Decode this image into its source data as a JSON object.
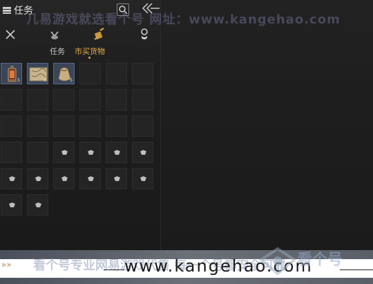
{
  "panel": {
    "title": "任务",
    "title_icon": "stack-icon",
    "search_icon": "search-icon",
    "collapse_icon": "double-chevron-left-icon"
  },
  "category_tabs": [
    {
      "icon": "crossed-swords-icon",
      "active": false
    },
    {
      "icon": "pouch-icon",
      "active": false
    },
    {
      "icon": "goods-bundle-icon",
      "active": true
    },
    {
      "icon": "coin-stack-icon",
      "active": false
    }
  ],
  "subtabs": {
    "inactive_label": "任务",
    "active_label": "市买货物"
  },
  "items": [
    {
      "icon": "lantern-icon",
      "count": "5"
    },
    {
      "icon": "map-scroll-icon",
      "count": "5"
    },
    {
      "icon": "grain-sack-icon",
      "count": "5"
    }
  ],
  "watermark": {
    "top_text": "几易游戏就选看个号  网址：www.kangehao.com",
    "banner_text": "看个号专业网易游戏代售  每一个号都安全可靠",
    "domain": "www.kangehao.com",
    "logo_text": "看个号",
    "arrows": "»»"
  },
  "colors": {
    "accent": "#e5b04c",
    "item_slot": "#3a4658",
    "empty_slot": "#242424"
  }
}
